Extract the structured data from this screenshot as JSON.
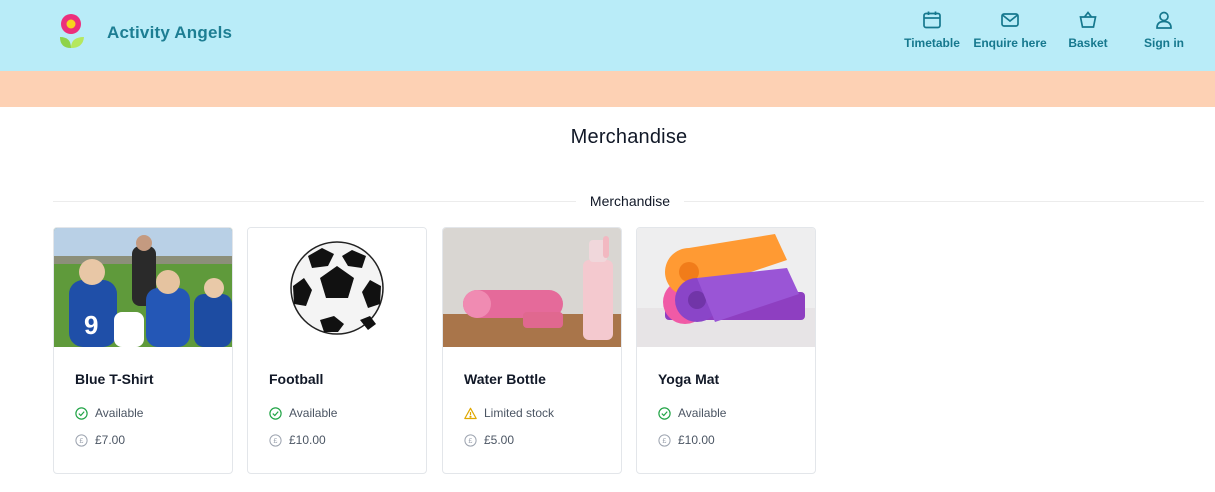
{
  "brand": {
    "name": "Activity Angels"
  },
  "nav": [
    {
      "label": "Timetable",
      "icon": "calendar-icon"
    },
    {
      "label": "Enquire here",
      "icon": "envelope-icon"
    },
    {
      "label": "Basket",
      "icon": "basket-icon"
    },
    {
      "label": "Sign in",
      "icon": "user-icon"
    }
  ],
  "page": {
    "title": "Merchandise",
    "section_label": "Merchandise"
  },
  "products": [
    {
      "name": "Blue T-Shirt",
      "status": "Available",
      "status_icon": "check-circle-icon",
      "price": "£7.00"
    },
    {
      "name": "Football",
      "status": "Available",
      "status_icon": "check-circle-icon",
      "price": "£10.00"
    },
    {
      "name": "Water Bottle",
      "status": "Limited stock",
      "status_icon": "warning-icon",
      "price": "£5.00"
    },
    {
      "name": "Yoga Mat",
      "status": "Available",
      "status_icon": "check-circle-icon",
      "price": "£10.00"
    }
  ],
  "colors": {
    "header_bg": "#b9ecf8",
    "banner_bg": "#fdd1b4",
    "brand_text": "#1d7e93",
    "available": "#22a447",
    "limited": "#e0a800"
  }
}
